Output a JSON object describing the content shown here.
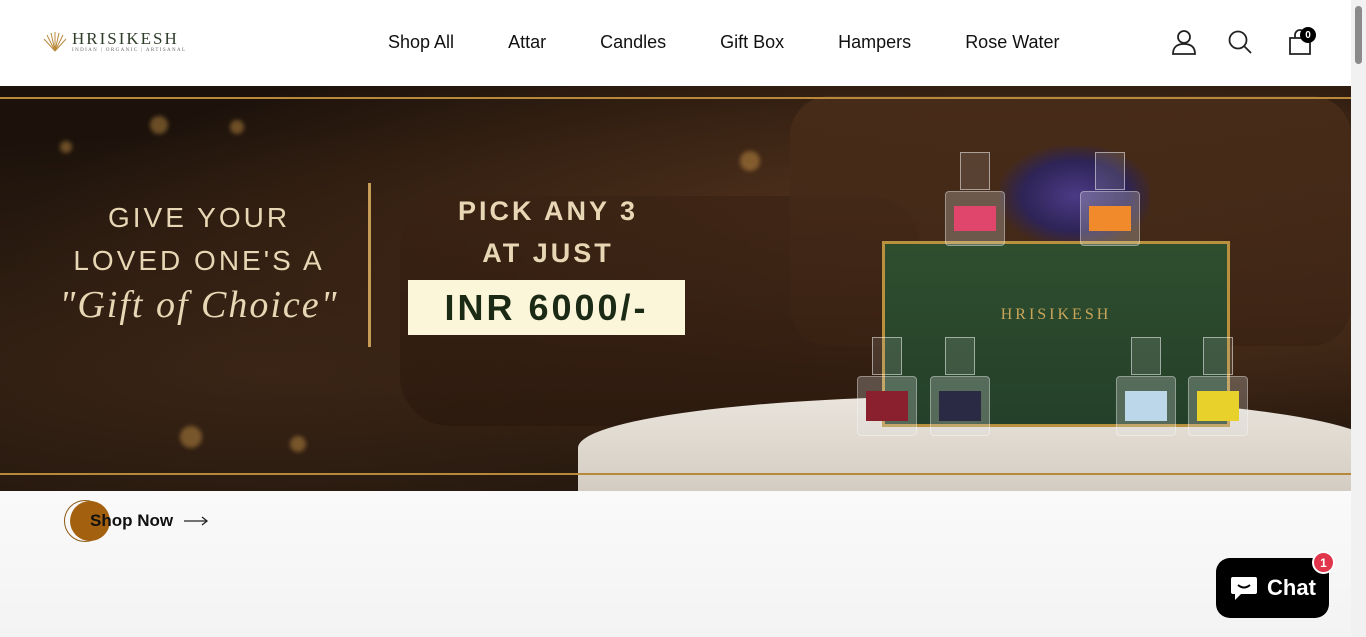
{
  "brand": {
    "name": "HRISIKESH",
    "tagline": "INDIAN | ORGANIC | ARTISANAL"
  },
  "nav": {
    "items": [
      {
        "label": "Shop All"
      },
      {
        "label": "Attar"
      },
      {
        "label": "Candles"
      },
      {
        "label": "Gift Box"
      },
      {
        "label": "Hampers"
      },
      {
        "label": "Rose Water"
      }
    ]
  },
  "header_icons": {
    "account": "user-icon",
    "search": "search-icon",
    "cart": "bag-icon",
    "cart_count": "0"
  },
  "hero": {
    "line1": "GIVE YOUR",
    "line2": "LOVED ONE'S A",
    "line3": "\"Gift of Choice\"",
    "offer_line1": "PICK ANY 3",
    "offer_line2": "AT JUST",
    "price": "INR 6000/-",
    "box_brand": "HRISIKESH"
  },
  "cta": {
    "label": "Shop Now",
    "arrow": "arrow-right-icon"
  },
  "chat": {
    "label": "Chat",
    "badge": "1"
  },
  "colors": {
    "accent_gold": "#b8893a",
    "cta_brown": "#a3610f",
    "price_box_bg": "#fbf5d9",
    "gift_box_green": "#2f4e2e",
    "chat_badge": "#e0354b"
  }
}
